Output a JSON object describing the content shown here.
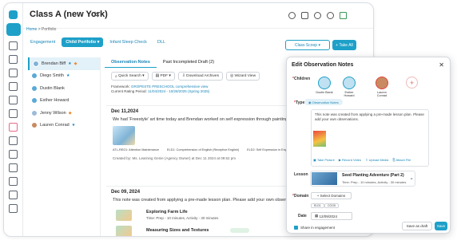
{
  "header": {
    "title": "Class A (new York)",
    "swap_icon": "swap-icon"
  },
  "breadcrumb": {
    "home": "Home",
    "sep": ">",
    "current": "Portfolio"
  },
  "subnav": [
    "Engagement",
    "Child Portfolio",
    "Infant Sleep Check",
    "DLL"
  ],
  "actions": {
    "class_scoop": "Class Scoop",
    "take_all": "Take All"
  },
  "students": [
    {
      "name": "Brendan Biff",
      "sel": true
    },
    {
      "name": "Diego Smith"
    },
    {
      "name": "Dustin Blank"
    },
    {
      "name": "Esther Howard"
    },
    {
      "name": "Jenny Wilson"
    },
    {
      "name": "Lauren Conrad"
    }
  ],
  "tabs": {
    "notes": "Observation Notes",
    "past": "Past Incompleted Draft (2)"
  },
  "tools": {
    "share": "Quick Search",
    "pdf": "PDF",
    "download": "Download Archives",
    "view": "Wizard View"
  },
  "framework": {
    "label": "Framework:",
    "value": "GROPESTE PRESCHOOL comprehensive view",
    "period_label": "Current Rating Period:",
    "period_value": "11/04/2024 - 10/28/2025 (Spring 2025)"
  },
  "entry1": {
    "date": "Dec 11,2024",
    "text": "We had 'Freestyle' art time today and Brendan worked on self expression through painting and d",
    "tags": [
      "ATL-REG1: Attention Maintenance",
      "ELD1: Comprehension of English (Receptive English)",
      "ELD2: Self Expression in Eng"
    ],
    "meta": "Created by: Ms. Learning Genie (Agency Owner) at Dec 11 2024 at 09:52 pm"
  },
  "entry2": {
    "date": "Dec 09, 2024",
    "text": "This note was created from applying a pre-made lesson plan. Please add your own observations",
    "act1_title": "Exploring Farm Life",
    "act1_sub": "Time: Prep - 10 minutes, Activity - 30 minutes",
    "act2_title": "Measuring Sizes and Textures"
  },
  "modal": {
    "title": "Edit Observation Notes",
    "children_label": "Children",
    "kids": [
      "Dustin Blank",
      "Esther Howard",
      "Lauren Conrad"
    ],
    "type_label": "Type",
    "type_value": "Observation Notes",
    "note_text": "This note was created from applying a pre-made lesson plan. Please add your own observations.",
    "note_tools": [
      "Take Picture",
      "Record Video",
      "Upload Media",
      "Attach File"
    ],
    "lesson_label": "Lesson",
    "lesson_title": "Seed Planting Adventure (Part 2)",
    "lesson_sub": "Time: Prep - 10 minutes, Activity - 30 minutes",
    "domain_label": "Domain",
    "domain_btn": "+ Select Domains",
    "domain_chips": [
      "ELD1",
      "COG5"
    ],
    "date_label": "Date",
    "date_value": "12/09/2024",
    "share": "Share in engagement",
    "draft": "Save as draft",
    "save": "Save"
  },
  "colors": {
    "accent": "#1ea0c8"
  }
}
